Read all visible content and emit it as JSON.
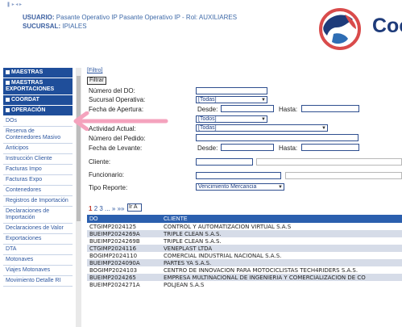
{
  "header": {
    "crumb": "❚ ▸ ◂ ▸",
    "usuario_key": "USUARIO:",
    "usuario_val": "Pasante Operativo IP Pasante Operativo IP - Rol: AUXILIARES",
    "sucursal_key": "SUCURSAL:",
    "sucursal_val": "IPIALES",
    "logo_text": "Coe"
  },
  "sidebar": {
    "sections": [
      {
        "label": "MAESTRAS"
      },
      {
        "label": "MAESTRAS EXPORTACIONES"
      },
      {
        "label": "COORDAT"
      },
      {
        "label": "OPERACIÓN"
      }
    ],
    "items": [
      {
        "label": "DOs"
      },
      {
        "label": "Reserva de Contenedores Masivo"
      },
      {
        "label": "Anticipos"
      },
      {
        "label": "Instrucción Cliente"
      },
      {
        "label": "Facturas Impo"
      },
      {
        "label": "Facturas Expo"
      },
      {
        "label": "Contenedores"
      },
      {
        "label": "Registros de Importación"
      },
      {
        "label": "Declaraciones de Importación"
      },
      {
        "label": "Declaraciones de Valor"
      },
      {
        "label": "Exportaciones"
      },
      {
        "label": "DTA"
      },
      {
        "label": "Motonaves"
      },
      {
        "label": "Viajes Motonaves"
      },
      {
        "label": "Movimiento Detalle RI"
      }
    ]
  },
  "filters": {
    "link": "[Filtro]",
    "button": "Filtrar",
    "numero_do": "Número del DO:",
    "sucursal": "Sucursal Operativa:",
    "sucursal_val": "[Todas]",
    "fecha_apertura": "Fecha de Apertura:",
    "desde": "Desde:",
    "hasta": "Hasta:",
    "fourth_select_val": "[Todos]",
    "actividad": "Actividad Actual:",
    "actividad_val": "[Todas]",
    "numero_pedido": "Número del Pedido:",
    "fecha_levante": "Fecha de Levante:",
    "cliente": "Cliente:",
    "funcionario": "Funcionario:",
    "tipo_reporte": "Tipo Reporte:",
    "tipo_reporte_val": "Vencimiento Mercancia"
  },
  "pager": {
    "current": "1",
    "pages": "2 3 ... » »»",
    "goto_val": "Ir A"
  },
  "table": {
    "headers": [
      "DO",
      "CLIENTE"
    ],
    "rows": [
      [
        "CTGIMP2024125",
        "CONTROL Y AUTOMATIZACION VIRTUAL S.A.S"
      ],
      [
        "BUEIMP2024269A",
        "TRIPLE CLEAN S.A.S."
      ],
      [
        "BUEIMP2024269B",
        "TRIPLE CLEAN S.A.S."
      ],
      [
        "CTGIMP2024116",
        "VENEPLAST LTDA"
      ],
      [
        "BOGIMP2024110",
        "COMERCIAL INDUSTRIAL NACIONAL S.A.S."
      ],
      [
        "BUEIMP2024090A",
        "PARTES YA S.A.S."
      ],
      [
        "BOGIMP2024103",
        "CENTRO DE INNOVACION PARA MOTOCICLISTAS TECH4RIDERS S.A.S."
      ],
      [
        "BUEIMP2024265",
        "EMPRESA MULTINACIONAL DE INGENIERIA Y COMERCIALIZACION DE CO"
      ],
      [
        "BUEIMP2024271A",
        "POLJEAN S.A.S"
      ]
    ]
  },
  "colors": {
    "nav_blue": "#1f4e9a",
    "table_header": "#2b5fae",
    "arrow_pink": "#f4a3bd"
  }
}
